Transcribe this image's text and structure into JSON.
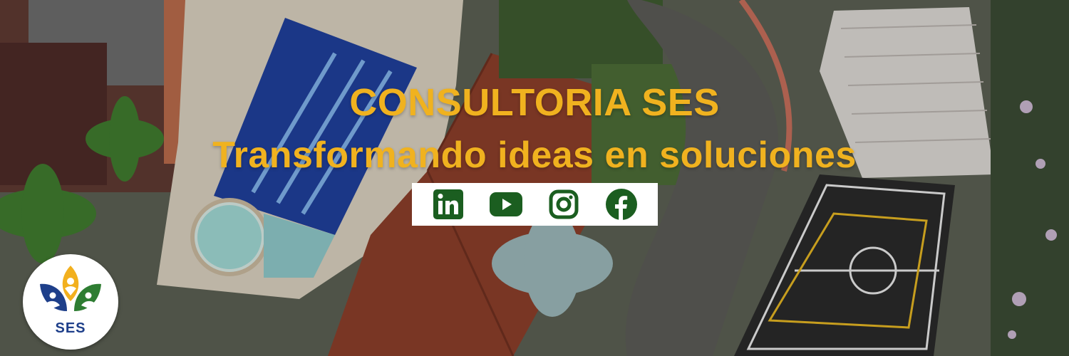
{
  "banner": {
    "title": "CONSULTORIA SES",
    "subtitle": "Transformando ideas en soluciones",
    "title_color": "#f0b21f"
  },
  "social": {
    "icon_color": "#1b5e20",
    "items": [
      {
        "name": "linkedin-icon"
      },
      {
        "name": "youtube-icon"
      },
      {
        "name": "instagram-icon"
      },
      {
        "name": "facebook-icon"
      }
    ]
  },
  "logo": {
    "text": "SES",
    "colors": {
      "blue": "#1e3f8a",
      "green": "#2e7d32",
      "yellow": "#f2b01e"
    }
  }
}
